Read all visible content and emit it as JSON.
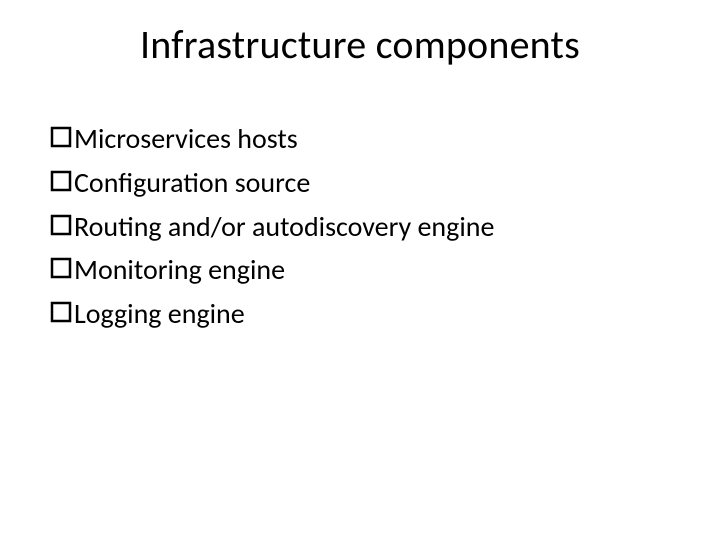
{
  "title": "Infrastructure components",
  "items": [
    {
      "label": "Microservices hosts"
    },
    {
      "label": "Configuration source"
    },
    {
      "label": "Routing and/or autodiscovery engine"
    },
    {
      "label": "Monitoring engine"
    },
    {
      "label": "Logging engine"
    }
  ]
}
